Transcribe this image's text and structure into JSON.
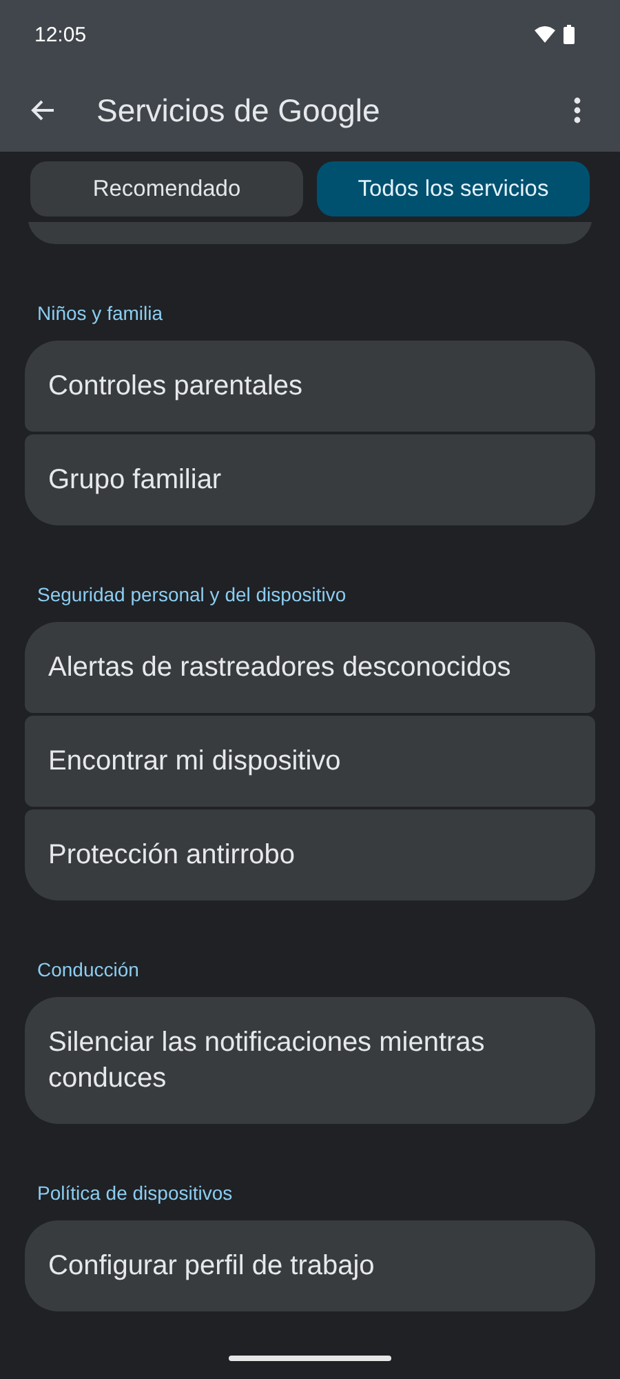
{
  "status_bar": {
    "time": "12:05"
  },
  "app_bar": {
    "title": "Servicios de Google"
  },
  "tabs": [
    {
      "label": "Recomendado",
      "selected": false
    },
    {
      "label": "Todos los servicios",
      "selected": true
    }
  ],
  "sections": [
    {
      "heading": "Niños y familia",
      "items": [
        "Controles parentales",
        "Grupo familiar"
      ]
    },
    {
      "heading": "Seguridad personal y del dispositivo",
      "items": [
        "Alertas de rastreadores desconocidos",
        "Encontrar mi dispositivo",
        "Protección antirrobo"
      ]
    },
    {
      "heading": "Conducción",
      "items": [
        "Silenciar las notificaciones mientras conduces"
      ]
    },
    {
      "heading": "Política de dispositivos",
      "items": [
        "Configurar perfil de trabajo"
      ]
    }
  ]
}
